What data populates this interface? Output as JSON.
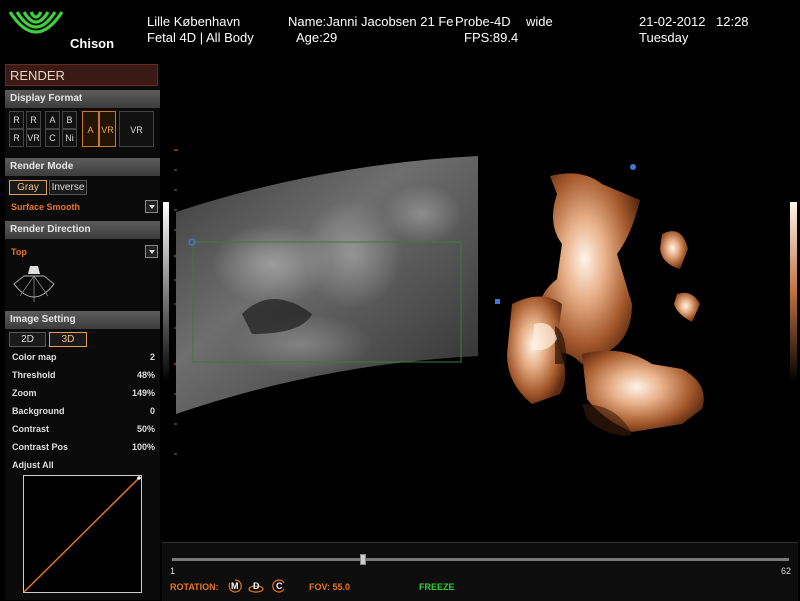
{
  "header": {
    "brand": "Chison",
    "hospital": "Lille København",
    "patient_name": "Name:Janni Jacobsen 21 Fe",
    "age": "Age:29",
    "probe": "Probe-4D",
    "probe_mode": "wide",
    "preset": "Fetal 4D | All Body",
    "fps": "FPS:89.4",
    "date": "21-02-2012",
    "time": "12:28",
    "weekday": "Tuesday"
  },
  "panel": {
    "title": "RENDER",
    "display_format": {
      "label": "Display Format",
      "buttons": [
        "R",
        "R",
        "A",
        "B",
        "R",
        "VR",
        "C",
        "Ni",
        "A",
        "VR",
        "VR"
      ],
      "selected": [
        "A",
        "VR"
      ]
    },
    "render_mode": {
      "label": "Render Mode",
      "gray": "Gray",
      "inverse": "Inverse",
      "selected": "Gray",
      "surface": "Surface Smooth"
    },
    "render_direction": {
      "label": "Render Direction",
      "value": "Top"
    },
    "image_setting": {
      "label": "Image Setting",
      "tab_2d": "2D",
      "tab_3d": "3D",
      "selected_tab": "3D",
      "rows": [
        {
          "label": "Color map",
          "value": "2"
        },
        {
          "label": "Threshold",
          "value": "48%"
        },
        {
          "label": "Zoom",
          "value": "149%"
        },
        {
          "label": "Background",
          "value": "0"
        },
        {
          "label": "Contrast",
          "value": "50%"
        },
        {
          "label": "Contrast Pos",
          "value": "100%"
        }
      ],
      "adjust_all": "Adjust All"
    }
  },
  "bottom": {
    "slider_min": "1",
    "slider_max": "62",
    "slider_value_fraction": 0.31,
    "rotation": "ROTATION:",
    "rot_m": "M",
    "rot_d": "D",
    "rot_c": "C",
    "fov": "FOV: 55.0",
    "freeze": "FREEZE"
  },
  "colors": {
    "accent_orange": "#e8761e",
    "freeze_green": "#33cc33",
    "title_bar": "#3a1a14",
    "roi_green": "#3b7a3b"
  }
}
